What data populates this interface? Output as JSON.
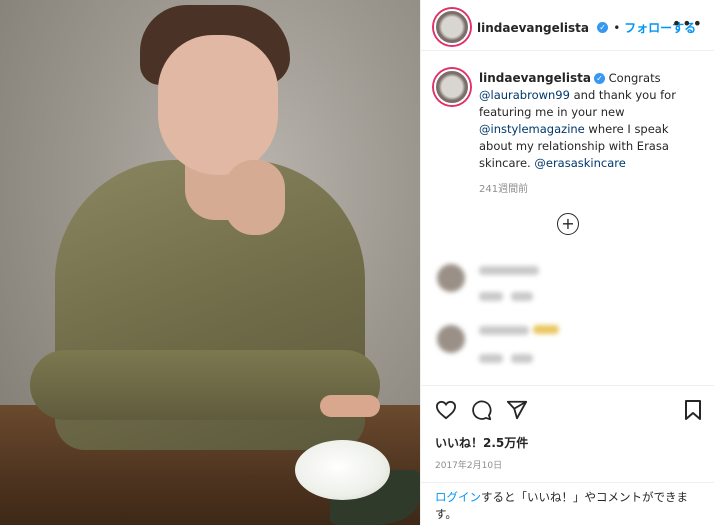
{
  "post": {
    "username": "lindaevangelista",
    "follow_label": "フォローする",
    "verified_mark": "✓",
    "more_label": "•••"
  },
  "caption": {
    "username": "lindaevangelista",
    "text_1": " Congrats ",
    "mention_1": "@laurabrown99",
    "text_2": " and thank you for featuring me in your new ",
    "mention_2": "@instylemagazine",
    "text_3": " where I speak about my relationship with Erasa skincare. ",
    "mention_3": "@erasaskincare",
    "time_ago": "241週間前"
  },
  "load_more_icon": "plus-circle-icon",
  "likes_label": "いいね！2.5万件",
  "post_date": "2017年2月10日",
  "login_prompt": {
    "link": "ログイン",
    "text": "すると「いいね！」やコメントができます。"
  },
  "colors": {
    "accent": "#0095f6",
    "mention": "#00376b",
    "muted": "#8e8e8e",
    "story_ring": "#e1306c"
  }
}
